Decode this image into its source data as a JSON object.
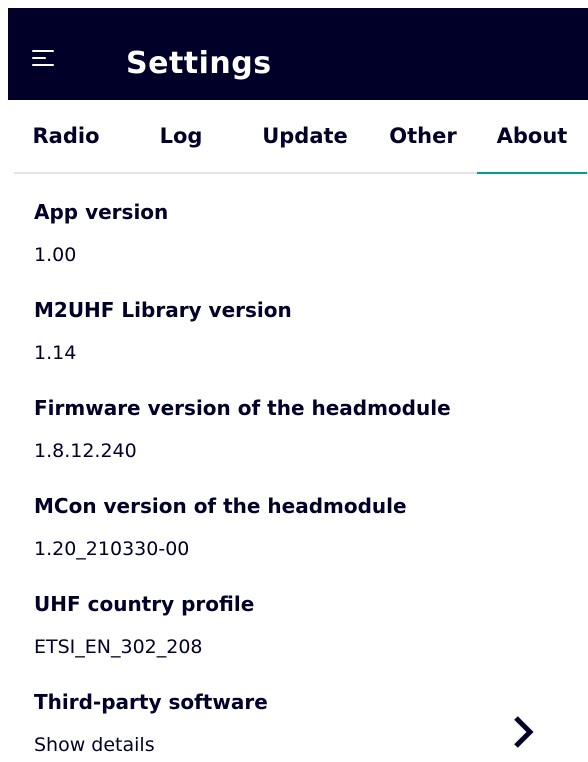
{
  "appbar": {
    "title": "Settings",
    "menu_icon": "hamburger-menu-icon"
  },
  "tabs": [
    {
      "label": "Radio",
      "active": false
    },
    {
      "label": "Log",
      "active": false
    },
    {
      "label": "Update",
      "active": false
    },
    {
      "label": "Other",
      "active": false
    },
    {
      "label": "About",
      "active": true
    }
  ],
  "about": {
    "app_version": {
      "label": "App version",
      "value": "1.00"
    },
    "library_version": {
      "label": "M2UHF Library version",
      "value": "1.14"
    },
    "firmware_version": {
      "label": "Firmware version of the headmodule",
      "value": "1.8.12.240"
    },
    "mcon_version": {
      "label": "MCon version of the headmodule",
      "value": "1.20_210330-00"
    },
    "country_profile": {
      "label": "UHF country profile",
      "value": "ETSI_EN_302_208"
    },
    "third_party": {
      "label": "Third-party software",
      "value": "Show details",
      "icon": "chevron-right-icon"
    }
  },
  "colors": {
    "appbar_bg": "#000028",
    "text": "#000028",
    "accent": "#009999",
    "divider": "#e3e3e6"
  }
}
